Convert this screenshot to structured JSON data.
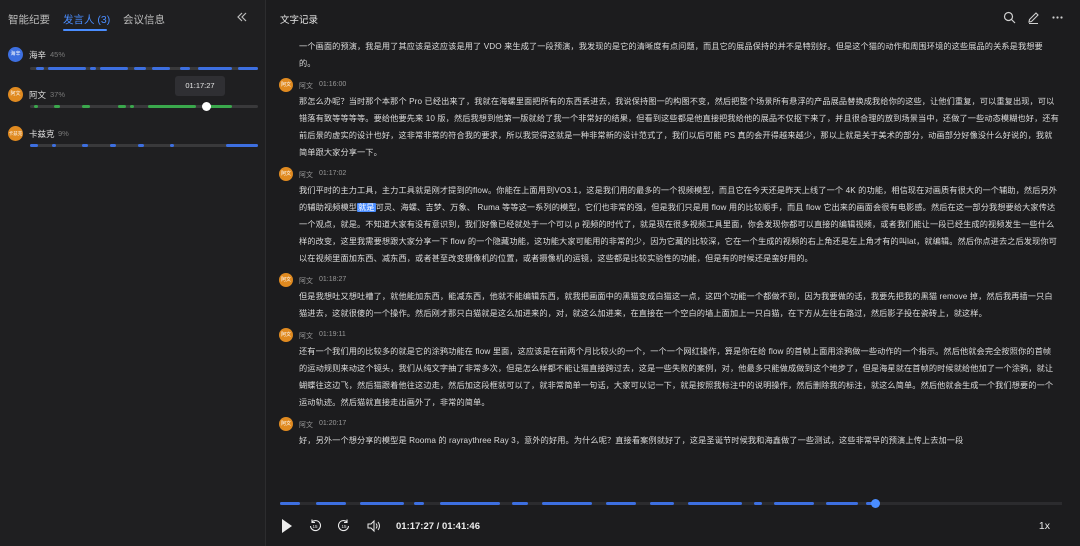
{
  "left": {
    "tabs": [
      "智能纪要",
      "发言人 (3)",
      "会议信息"
    ],
    "speakers": [
      {
        "avatar_text": "海辛",
        "name": "海辛",
        "pct": "45%",
        "color": "#3d6fe0"
      },
      {
        "avatar_text": "阿文",
        "name": "阿文",
        "pct": "37%",
        "color": "#e08a20"
      },
      {
        "avatar_text": "卡兹克",
        "name": "卡兹克",
        "pct": "9%",
        "color": "#e08a20"
      }
    ],
    "tooltip_time": "01:17:27"
  },
  "right": {
    "title": "文字记录",
    "icons": [
      "search-icon",
      "edit-icon",
      "more-icon"
    ],
    "first_text": "一个画面的预演，我是用了其应该是这应该是用了 VDO 来生成了一段预演，我发现的是它的清晰度有点问题，而且它的展品保持的并不是特别好。但是这个猫的动作和周围环境的这些展品的关系是我想要的。",
    "segments": [
      {
        "speaker": "阿文",
        "time": "01:16:00",
        "text_before": "那怎么办呢？当时那个本那个 Pro 已经出来了，我就在海螺里面把所有的东西丢进去，我说保持图一的构图不变，然后把整个场景所有悬浮的产品展品替换成我给你的这些，让他们重复，可以重复出现，可以错落有致等等等等。要给他要先来 10 版，然后我想到他第一版就给了我一个非常好的结果，但看到这些都是他直接把我给他的展品不仅抠下来了，并且很合理的放到场景当中，还做了一些动态模糊也好，还有前后景的虚实的设计也好，这非常非常的符合我的要求，所以我觉得这就是一种非常新的设计范式了，我们以后可能 PS 真的会开得越来越少，那以上就是关于美术的部分，动画部分好像没什么好说的，我就简单跟大家分享一下。",
        "highlight": "",
        "text_after": ""
      },
      {
        "speaker": "阿文",
        "time": "01:17:02",
        "text_before": "我们平时的主力工具，主力工具就是刚才提到的flow。你能在上面用到VO3.1，这是我们用的最多的一个视频模型，而且它在今天还是昨天上线了一个 4K 的功能，相信现在对画质有很大的一个辅助，然后另外的辅助视频模型",
        "highlight": "就是",
        "text_after": "可灵、海螺、吉梦、万象、 Ruma 等等这一系列的模型，它们也非常的强，但是我们只是用 flow 用的比较顺手，而且 flow 它出来的画面会很有电影感。然后在这一部分我想要给大家传达一个观点，就是。不知道大家有没有意识到，我们好像已经就处于一个可以 p 视频的时代了，就是现在很多视频工具里面，你会发现你都可以直接的编辑视频，或者我们能让一段已经生成的视频发生一些什么样的改变，这里我需要想跟大家分享一下 flow 的一个隐藏功能，这功能大家可能用的非常的少，因为它藏的比较深，它在一个生成的视频的右上角还是左上角才有的叫lat，就编辑。然后你点进去之后发现你可以在视频里面加东西、减东西，或者甚至改变摄像机的位置，或者摄像机的运镜，这些都是比较实验性的功能，但是有的时候还是蛮好用的。"
      },
      {
        "speaker": "阿文",
        "time": "01:18:27",
        "text_before": "但是我想吐又想吐槽了，就他能加东西，能减东西，他就不能编辑东西，就我把画面中的黑猫变成白猫这一点，这四个功能一个都做不到，因为我要做的话，我要先把我的黑猫 remove 掉，然后我再插一只白猫进去，这就很傻的一个操作。然后刚才那只白猫就是这么加进来的，对，就这么加进来，在直接在一个空白的墙上面加上一只白猫，在下方从左往右路过，然后影子投在瓷砖上，就这样。",
        "highlight": "",
        "text_after": ""
      },
      {
        "speaker": "阿文",
        "time": "01:19:11",
        "text_before": "还有一个我们用的比较多的就是它的涂鸦功能在 flow 里面，这应该是在前两个月比较火的一个，一个一个网红操作，算是你在给 flow 的首帧上面用涂鸦做一些动作的一个指示。然后他就会完全按照你的首帧的运动规则来动这个镜头，我们从纯文字抽了非常多次，但是怎么样都不能让猫直接跨过去，这是一些失败的案例，对，他最多只能做成做到这个地步了，但是海星就在首帧的时候就给他加了一个涂鸦，就让蝴蝶往这边飞，然后猫跟着他往这边走，然后加这段框就可以了，就非常简单一句话，大家可以记一下，就是按照我标注中的说明操作，然后删除我的标注，就这么简单。然后他就会生成一个我们想要的一个运动轨迹。然后猫就直接走出画外了，非常的简单。",
        "highlight": "",
        "text_after": ""
      },
      {
        "speaker": "阿文",
        "time": "01:20:17",
        "text_before": "好，另外一个想分享的模型是 Rooma 的 rayraythree Ray 3，意外的好用。为什么呢？直接看案例就好了，这是圣诞节时候我和海鑫做了一些测试，这些非常早的预演上传上去加一段",
        "highlight": "",
        "text_after": ""
      }
    ]
  },
  "player": {
    "current": "01:17:27",
    "total": "01:41:46",
    "time_display": "01:17:27 / 01:41:46",
    "speed": "1x",
    "progress": 0.761
  },
  "colors": {
    "accent": "#4a8dff",
    "hai": "#3d6fe0",
    "awen": "#e08a20",
    "green": "#3aa84c"
  }
}
